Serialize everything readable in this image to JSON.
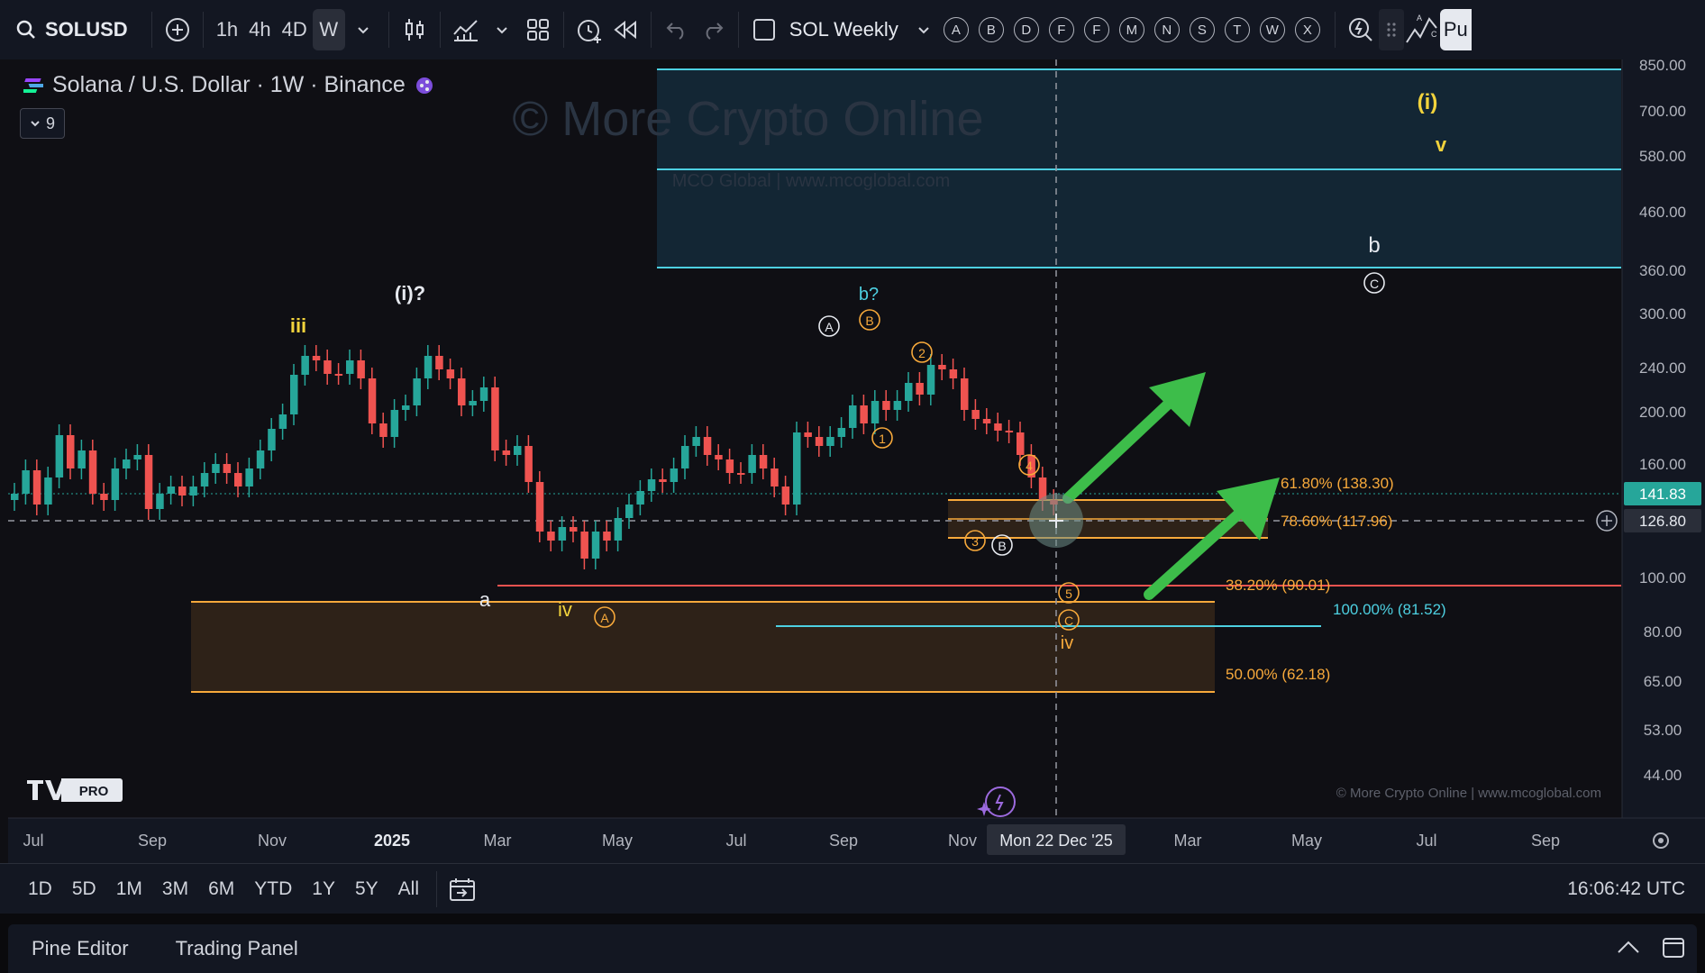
{
  "toolbar": {
    "symbol": "SOLUSD",
    "intervals": [
      "1h",
      "4h",
      "4D",
      "W"
    ],
    "active_interval": "W",
    "layout_name": "SOL Weekly",
    "letter_buttons": [
      "A",
      "B",
      "D",
      "F",
      "F",
      "M",
      "N",
      "S",
      "T",
      "W",
      "X"
    ],
    "publish_label": "Pu"
  },
  "legend": {
    "title": "Solana / U.S. Dollar · 1W · Binance",
    "indicator_count": "9"
  },
  "watermark": {
    "main": "© More Crypto Online",
    "sub": "MCO Global  |  www.mcoglobal.com",
    "footer": "© More Crypto Online  |  www.mcoglobal.com"
  },
  "price_axis": {
    "ticks": [
      "850.00",
      "700.00",
      "580.00",
      "460.00",
      "360.00",
      "300.00",
      "240.00",
      "200.00",
      "160.00",
      "100.00",
      "80.00",
      "65.00",
      "53.00",
      "44.00"
    ],
    "last_price": "141.83",
    "crosshair_price": "126.80",
    "last_price_color": "#26a69a"
  },
  "time_axis": {
    "labels": [
      "Jul",
      "Sep",
      "Nov",
      "2025",
      "Mar",
      "May",
      "Jul",
      "Sep",
      "Nov",
      "Mar",
      "May",
      "Jul",
      "Sep"
    ],
    "crosshair_date": "Mon 22 Dec '25"
  },
  "annotations": {
    "fib_618": "61.80% (138.30)",
    "fib_786": "78.60% (117.96)",
    "fib_382": "38.20% (90.01)",
    "fib_100": "100.00% (81.52)",
    "fib_50": "50.00% (62.18)",
    "wave_iii": "iii",
    "wave_i_q": "(i)?",
    "wave_b_q": "b?",
    "wave_A_circ": "A",
    "wave_B_circ": "B",
    "wave_1": "1",
    "wave_2": "2",
    "wave_3": "3",
    "wave_4": "4",
    "wave_5": "5",
    "wave_C_circ": "C",
    "wave_b": "b",
    "wave_C_white": "C",
    "wave_i": "(i)",
    "wave_v": "v",
    "wave_a": "a",
    "wave_iv_low": "iv",
    "wave_A_low": "A",
    "wave_iv_target": "iv",
    "wave_B_white": "B"
  },
  "logo": {
    "text": "PRO"
  },
  "range_buttons": [
    "1D",
    "5D",
    "1M",
    "3M",
    "6M",
    "YTD",
    "1Y",
    "5Y",
    "All"
  ],
  "clock": "16:06:42 UTC",
  "bottom_tabs": [
    "Pine Editor",
    "Trading Panel"
  ],
  "colors": {
    "up": "#26a69a",
    "down": "#ef5350",
    "orange": "#f7a93b",
    "cyan": "#4dd0e1",
    "yellow": "#f2d33c",
    "green_arrow": "#3dbd4a"
  }
}
